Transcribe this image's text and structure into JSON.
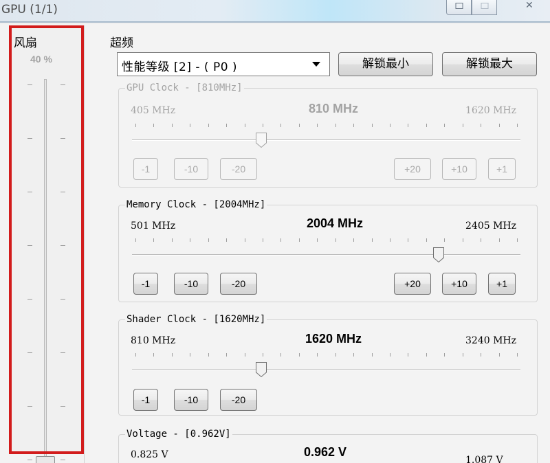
{
  "window": {
    "title": "GPU (1/1)",
    "close_glyph": "✕"
  },
  "fan": {
    "title": "风扇",
    "percent": "40 %",
    "level": 0.4
  },
  "overclock": {
    "title": "超频",
    "perf_level": "性能等级 [2] - ( P0 )",
    "unlock_min": "解锁最小",
    "unlock_max": "解锁最大"
  },
  "gpu_clock": {
    "label": "GPU Clock - [810MHz]",
    "min": "405 MHz",
    "current": "810 MHz",
    "max": "1620 MHz",
    "value": 810,
    "range": [
      405,
      1620
    ],
    "enabled": false,
    "buttons": {
      "m1": "-1",
      "m10": "-10",
      "m20": "-20",
      "p20": "+20",
      "p10": "+10",
      "p1": "+1"
    }
  },
  "memory_clock": {
    "label": "Memory Clock - [2004MHz]",
    "min": "501 MHz",
    "current": "2004 MHz",
    "max": "2405 MHz",
    "value": 2004,
    "range": [
      501,
      2405
    ],
    "enabled": true,
    "buttons": {
      "m1": "-1",
      "m10": "-10",
      "m20": "-20",
      "p20": "+20",
      "p10": "+10",
      "p1": "+1"
    }
  },
  "shader_clock": {
    "label": "Shader Clock - [1620MHz]",
    "min": "810 MHz",
    "current": "1620 MHz",
    "max": "3240 MHz",
    "value": 1620,
    "range": [
      810,
      3240
    ],
    "enabled": true,
    "buttons": {
      "m1": "-1",
      "m10": "-10",
      "m20": "-20"
    }
  },
  "voltage": {
    "label": "Voltage - [0.962V]",
    "min": "0.825 V",
    "current": "0.962 V",
    "max": "1.087 V"
  }
}
